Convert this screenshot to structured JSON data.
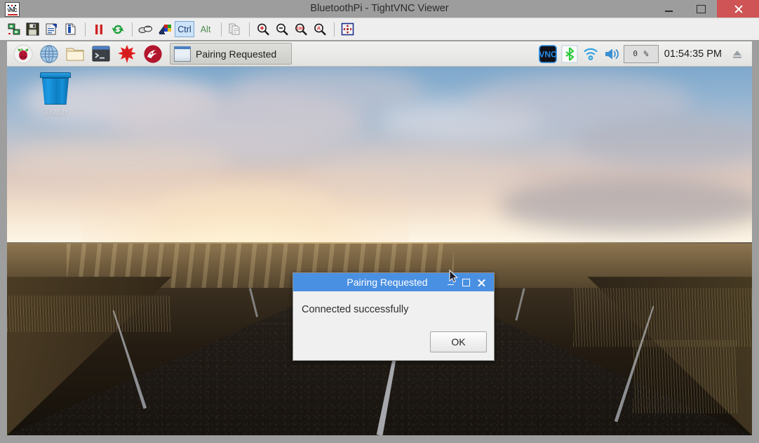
{
  "window": {
    "title": "BluetoothPi - TightVNC Viewer",
    "app_icon": "vnc-icon",
    "controls": {
      "minimize": "minimize-button",
      "maximize": "maximize-button",
      "close": "close-button"
    }
  },
  "vnc_toolbar": {
    "buttons": [
      {
        "name": "new-connection-icon",
        "tooltip": "New connection"
      },
      {
        "name": "save-session-icon",
        "tooltip": "Save session"
      },
      {
        "name": "connection-options-icon",
        "tooltip": "Connection options"
      },
      {
        "name": "connection-info-icon",
        "tooltip": "Connection info"
      },
      {
        "name": "pause-updates-icon",
        "tooltip": "Pause updates"
      },
      {
        "name": "refresh-screen-icon",
        "tooltip": "Refresh screen"
      },
      {
        "name": "send-ctrl-alt-del-icon",
        "tooltip": "Send Ctrl-Alt-Del"
      },
      {
        "name": "send-ctrl-esc-icon",
        "tooltip": "Send Ctrl-Esc"
      },
      {
        "name": "transfer-files-icon",
        "tooltip": "Transfer files"
      },
      {
        "name": "zoom-in-icon",
        "tooltip": "Zoom in"
      },
      {
        "name": "zoom-out-icon",
        "tooltip": "Zoom out"
      },
      {
        "name": "zoom-100-icon",
        "tooltip": "Zoom 100%"
      },
      {
        "name": "zoom-auto-icon",
        "tooltip": "Auto zoom"
      },
      {
        "name": "full-screen-icon",
        "tooltip": "Full screen"
      }
    ],
    "ctrl_label": "Ctrl",
    "alt_label": "Alt"
  },
  "taskbar": {
    "launchers": [
      {
        "name": "raspberry-menu-icon",
        "label": "Menu"
      },
      {
        "name": "web-browser-icon",
        "label": "Web Browser"
      },
      {
        "name": "file-manager-icon",
        "label": "File Manager"
      },
      {
        "name": "terminal-icon",
        "label": "Terminal"
      },
      {
        "name": "mathematica-icon",
        "label": "Mathematica"
      },
      {
        "name": "wolfram-icon",
        "label": "Wolfram"
      }
    ],
    "tasks": [
      {
        "label": "Pairing Requested",
        "active": true
      }
    ],
    "tray": [
      {
        "name": "vnc-server-icon",
        "label": "VNC"
      },
      {
        "name": "bluetooth-icon",
        "label": "Bluetooth"
      },
      {
        "name": "wifi-icon",
        "label": "Wireless"
      },
      {
        "name": "volume-icon",
        "label": "Volume"
      }
    ],
    "cpu_meter": "0 %",
    "clock": "01:54:35 PM",
    "eject_icon": "eject-icon"
  },
  "desktop": {
    "icons": [
      {
        "name": "trash-icon",
        "label": "Trash"
      }
    ]
  },
  "dialog": {
    "title": "Pairing Requested",
    "message": "Connected successfully",
    "ok_label": "OK",
    "controls": {
      "minimize": "minimize-button",
      "maximize": "maximize-button",
      "close": "close-button"
    }
  },
  "colors": {
    "dialog_titlebar": "#4a90e2",
    "close_button": "#cf5455",
    "ctrl_active": "#cde3fa",
    "alt_text": "#4e8a4e",
    "bluetooth": "#2ecc40"
  }
}
